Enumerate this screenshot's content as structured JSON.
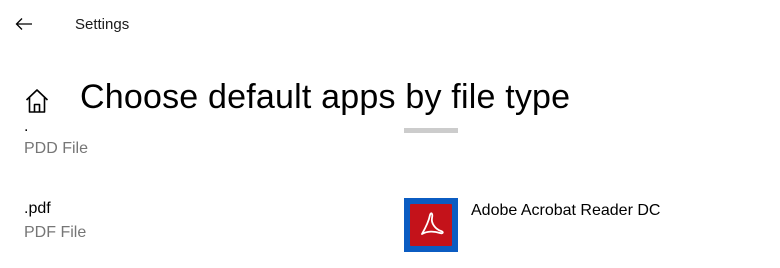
{
  "titlebar": {
    "back_icon": "back-arrow-icon",
    "title": "Settings"
  },
  "header": {
    "home_icon": "home-icon",
    "title": "Choose default apps by file type"
  },
  "file_types": [
    {
      "extension": ".",
      "description": "PDD File",
      "app_icon": "plus-icon",
      "app_name": ""
    },
    {
      "extension": ".pdf",
      "description": "PDF File",
      "app_icon": "adobe-acrobat-icon",
      "app_name": "Adobe Acrobat Reader DC"
    }
  ],
  "colors": {
    "choose_tile": "#cccccc",
    "app_tile": "#0b5cc2",
    "acrobat_red": "#c4121a"
  }
}
